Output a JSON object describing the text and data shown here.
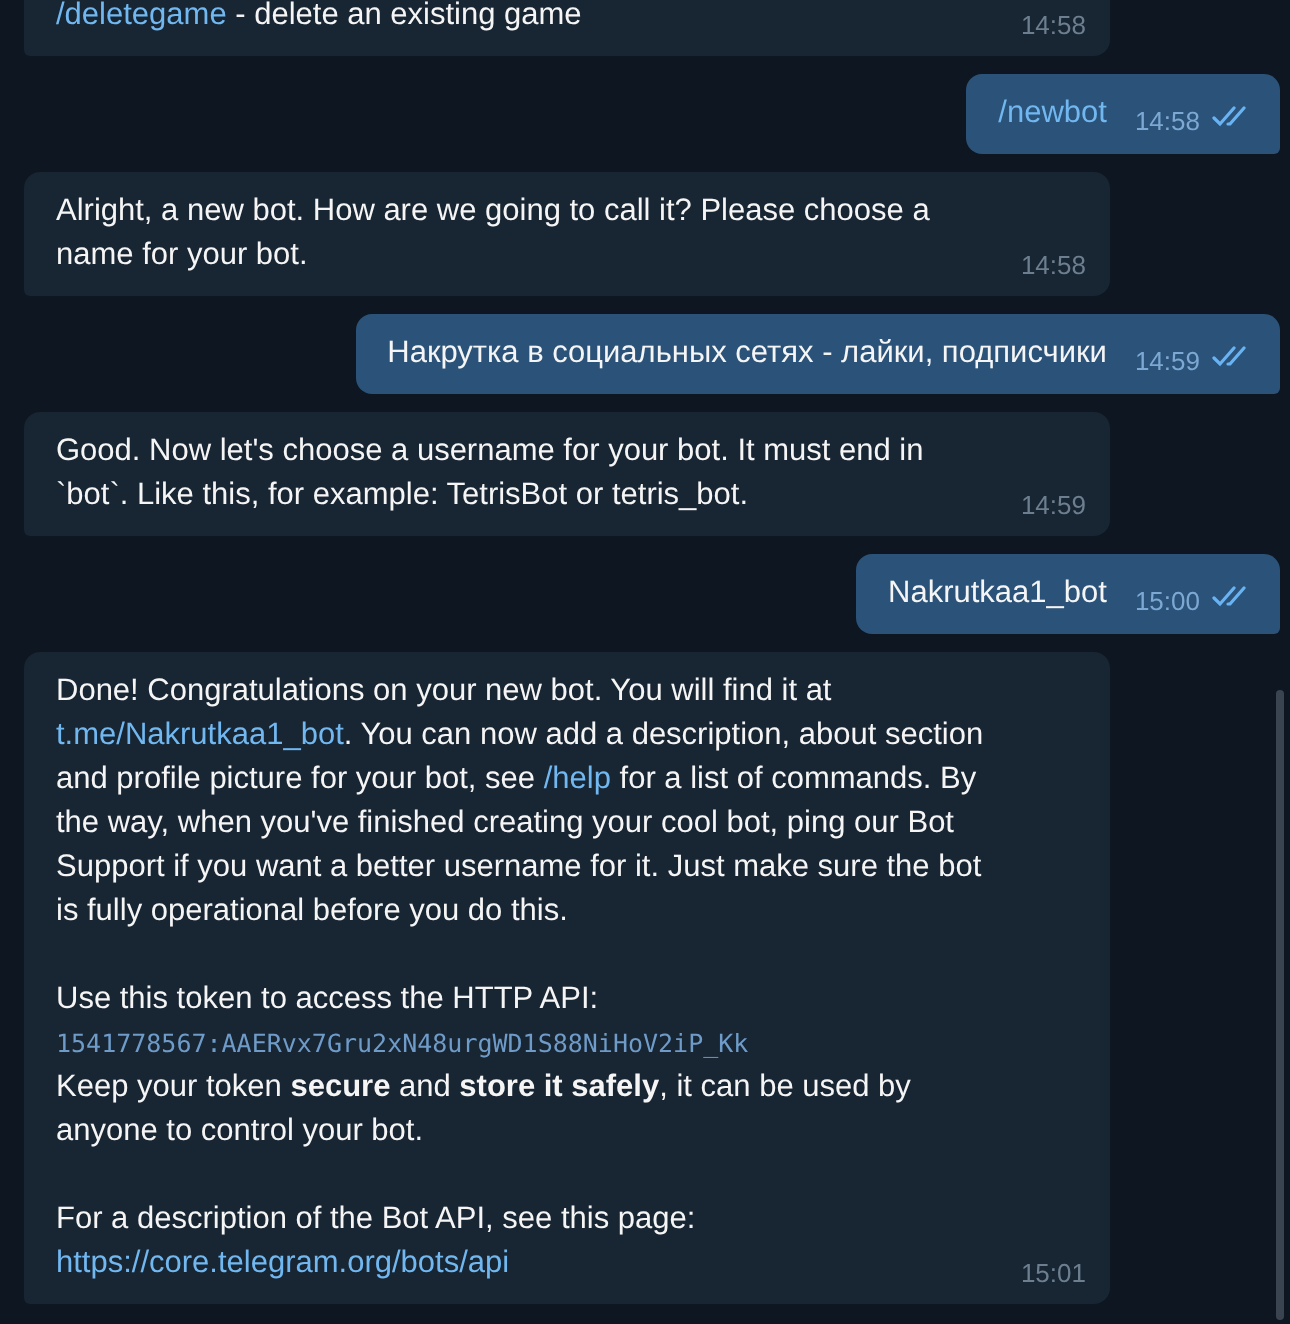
{
  "messages": [
    {
      "kind": "incoming",
      "time": "14:58",
      "paragraphs": [
        [
          {
            "kind": "link",
            "text": "/deletegame"
          },
          {
            "kind": "text",
            "text": " - delete an existing game"
          }
        ]
      ]
    },
    {
      "kind": "outgoing",
      "time": "14:58",
      "read": true,
      "paragraphs": [
        [
          {
            "kind": "link",
            "text": "/newbot"
          }
        ]
      ]
    },
    {
      "kind": "incoming",
      "time": "14:58",
      "paragraphs": [
        [
          {
            "kind": "text",
            "text": "Alright, a new bot. How are we going to call it? Please choose a name for your bot."
          }
        ]
      ]
    },
    {
      "kind": "outgoing",
      "time": "14:59",
      "read": true,
      "paragraphs": [
        [
          {
            "kind": "text",
            "text": "Накрутка в социальных сетях - лайки, подписчики"
          }
        ]
      ]
    },
    {
      "kind": "incoming",
      "time": "14:59",
      "paragraphs": [
        [
          {
            "kind": "text",
            "text": "Good. Now let's choose a username for your bot. It must end in `bot`. Like this, for example: TetrisBot or tetris_bot."
          }
        ]
      ]
    },
    {
      "kind": "outgoing",
      "time": "15:00",
      "read": true,
      "paragraphs": [
        [
          {
            "kind": "text",
            "text": "Nakrutkaa1_bot"
          }
        ]
      ]
    },
    {
      "kind": "incoming",
      "time": "15:01",
      "paragraphs": [
        [
          {
            "kind": "text",
            "text": "Done! Congratulations on your new bot. You will find it at "
          },
          {
            "kind": "link",
            "text": "t.me/Nakrutkaa1_bot"
          },
          {
            "kind": "text",
            "text": ". You can now add a description, about section and profile picture for your bot, see "
          },
          {
            "kind": "link",
            "text": "/help"
          },
          {
            "kind": "text",
            "text": " for a list of commands. By the way, when you've finished creating your cool bot, ping our Bot Support if you want a better username for it. Just make sure the bot is fully operational before you do this."
          }
        ],
        [
          {
            "kind": "blank"
          }
        ],
        [
          {
            "kind": "text",
            "text": "Use this token to access the HTTP API:"
          }
        ],
        [
          {
            "kind": "code",
            "text": "1541778567:AAERvx7Gru2xN48urgWD1S88NiHoV2iP_Kk"
          }
        ],
        [
          {
            "kind": "text",
            "text": "Keep your token **secure** and **store it safely**, it can be used by anyone to control your bot."
          }
        ],
        [
          {
            "kind": "blank"
          }
        ],
        [
          {
            "kind": "text",
            "text": "For a description of the Bot API, see this page: "
          },
          {
            "kind": "link",
            "text": "https://core.telegram.org/bots/api"
          }
        ]
      ]
    }
  ]
}
